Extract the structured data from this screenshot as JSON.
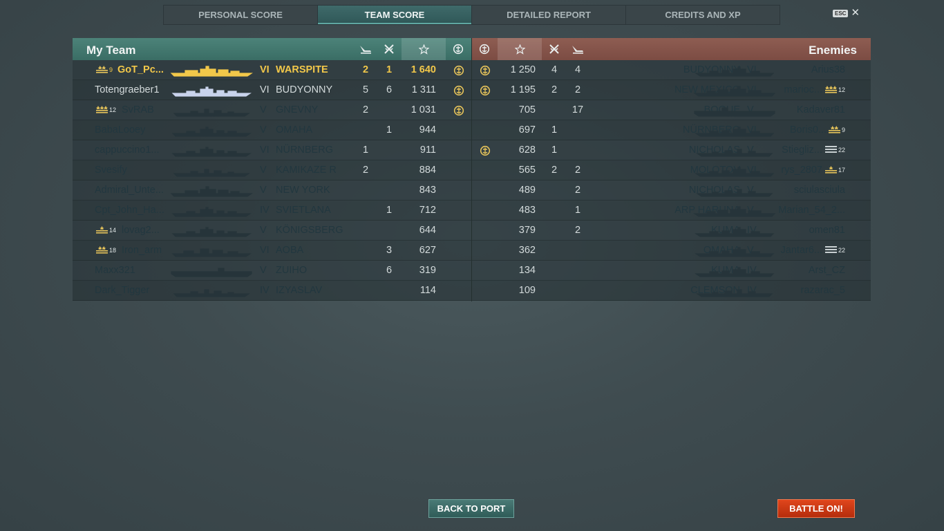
{
  "tabs": [
    "PERSONAL SCORE",
    "TEAM SCORE",
    "DETAILED REPORT",
    "CREDITS AND XP"
  ],
  "active_tab": 1,
  "esc_label": "ESC",
  "colors": {
    "my_team_header": "#4c8379",
    "enemy_header": "#8e5d52",
    "highlight_player": "#f2c84a",
    "battle_button": "#d23d16"
  },
  "my_team": {
    "title": "My Team",
    "header_icons": [
      "plane-icon",
      "crossed-swords-icon",
      "star-icon",
      "emblem-icon"
    ],
    "rows": [
      {
        "player": "GoT_Pc...",
        "rank_level": "9",
        "rank_icon": "ribbon-2-stars",
        "tier": "VI",
        "ship": "WARSPITE",
        "planes": "2",
        "kills": "1",
        "score": "1 640",
        "medal": "yes",
        "style": "me",
        "ship_class": "bb"
      },
      {
        "player": "Totengraeber1",
        "rank_level": "",
        "rank_icon": "",
        "tier": "VI",
        "ship": "BUDYONNY",
        "planes": "5",
        "kills": "6",
        "score": "1 311",
        "medal": "yes",
        "style": "lit",
        "ship_class": "cl"
      },
      {
        "player": "SvRAB",
        "rank_level": "12",
        "rank_icon": "ribbon-3-stars",
        "tier": "V",
        "ship": "GNEVNY",
        "planes": "2",
        "kills": "",
        "score": "1 031",
        "medal": "yes",
        "style": "dim",
        "ship_class": "dd"
      },
      {
        "player": "BabaLooey",
        "rank_level": "",
        "rank_icon": "",
        "tier": "V",
        "ship": "OMAHA",
        "planes": "",
        "kills": "1",
        "score": "944",
        "medal": "",
        "style": "dim",
        "ship_class": "cl"
      },
      {
        "player": "cappuccino1...",
        "rank_level": "",
        "rank_icon": "",
        "tier": "VI",
        "ship": "NÜRNBERG",
        "planes": "1",
        "kills": "",
        "score": "911",
        "medal": "",
        "style": "dim",
        "ship_class": "cl"
      },
      {
        "player": "Svesify",
        "rank_level": "",
        "rank_icon": "",
        "tier": "V",
        "ship": "KAMIKAZE R",
        "planes": "2",
        "kills": "",
        "score": "884",
        "medal": "",
        "style": "dim",
        "ship_class": "dd"
      },
      {
        "player": "Admiral_Unte...",
        "rank_level": "",
        "rank_icon": "",
        "tier": "V",
        "ship": "NEW YORK",
        "planes": "",
        "kills": "",
        "score": "843",
        "medal": "",
        "style": "dim",
        "ship_class": "bb"
      },
      {
        "player": "Cpt_John_Ha...",
        "rank_level": "",
        "rank_icon": "",
        "tier": "IV",
        "ship": "SVIETLANA",
        "planes": "",
        "kills": "1",
        "score": "712",
        "medal": "",
        "style": "dim",
        "ship_class": "cl"
      },
      {
        "player": "lovag2...",
        "rank_level": "14",
        "rank_icon": "ribbon-1-star",
        "tier": "V",
        "ship": "KÖNIGSBERG",
        "planes": "",
        "kills": "",
        "score": "644",
        "medal": "",
        "style": "dim",
        "ship_class": "cl"
      },
      {
        "player": "Iron_arm",
        "rank_level": "18",
        "rank_icon": "ribbon-2-stars",
        "tier": "VI",
        "ship": "AOBA",
        "planes": "",
        "kills": "3",
        "score": "627",
        "medal": "",
        "style": "dim",
        "ship_class": "ca"
      },
      {
        "player": "Maxx321",
        "rank_level": "",
        "rank_icon": "",
        "tier": "V",
        "ship": "ZUIHO",
        "planes": "",
        "kills": "6",
        "score": "319",
        "medal": "",
        "style": "dim",
        "ship_class": "cv"
      },
      {
        "player": "Dark_Tigger",
        "rank_level": "",
        "rank_icon": "",
        "tier": "IV",
        "ship": "IZYASLAV",
        "planes": "",
        "kills": "",
        "score": "114",
        "medal": "",
        "style": "dim",
        "ship_class": "dd"
      }
    ]
  },
  "enemies": {
    "title": "Enemies",
    "header_icons": [
      "emblem-icon",
      "star-icon",
      "crossed-swords-icon",
      "plane-icon"
    ],
    "rows": [
      {
        "player": "Arius38",
        "rank_level": "",
        "rank_icon": "",
        "tier": "VI",
        "ship": "BUDYONNY",
        "planes": "4",
        "kills": "4",
        "score": "1 250",
        "medal": "yes",
        "ship_class": "cl"
      },
      {
        "player": "marioc...",
        "rank_level": "12",
        "rank_icon": "ribbon-3-stars",
        "tier": "VI",
        "ship": "NEW MEXICO",
        "planes": "2",
        "kills": "2",
        "score": "1 195",
        "medal": "yes",
        "ship_class": "bb"
      },
      {
        "player": "Kadaver81",
        "rank_level": "",
        "rank_icon": "",
        "tier": "V",
        "ship": "BOGUE",
        "planes": "",
        "kills": "17",
        "score": "705",
        "medal": "",
        "ship_class": "cv"
      },
      {
        "player": "Boris0...",
        "rank_level": "9",
        "rank_icon": "ribbon-2-stars",
        "tier": "VI",
        "ship": "NÜRNBERG",
        "planes": "1",
        "kills": "",
        "score": "697",
        "medal": "",
        "ship_class": "cl"
      },
      {
        "player": "Stiegliz...",
        "rank_level": "22",
        "rank_icon": "ribbon-plain",
        "tier": "V",
        "ship": "NICHOLAS",
        "planes": "1",
        "kills": "",
        "score": "628",
        "medal": "yes",
        "ship_class": "dd"
      },
      {
        "player": "rys_2807",
        "rank_level": "17",
        "rank_icon": "ribbon-1-star",
        "tier": "VI",
        "ship": "MOLOTOV",
        "planes": "2",
        "kills": "2",
        "score": "565",
        "medal": "",
        "ship_class": "cl"
      },
      {
        "player": "sciulasciula",
        "rank_level": "",
        "rank_icon": "",
        "tier": "V",
        "ship": "NICHOLAS",
        "planes": "",
        "kills": "2",
        "score": "489",
        "medal": "",
        "ship_class": "dd"
      },
      {
        "player": "Marian_54_2...",
        "rank_level": "",
        "rank_icon": "",
        "tier": "V",
        "ship": "ARP HARUNA",
        "planes": "",
        "kills": "1",
        "score": "483",
        "medal": "",
        "ship_class": "bb"
      },
      {
        "player": "omen81",
        "rank_level": "",
        "rank_icon": "",
        "tier": "IV",
        "ship": "KUMA",
        "planes": "",
        "kills": "2",
        "score": "379",
        "medal": "",
        "ship_class": "cl"
      },
      {
        "player": "Jantar6...",
        "rank_level": "22",
        "rank_icon": "ribbon-plain",
        "tier": "V",
        "ship": "OMAHA",
        "planes": "",
        "kills": "",
        "score": "362",
        "medal": "",
        "ship_class": "cl"
      },
      {
        "player": "Arst_CZ",
        "rank_level": "",
        "rank_icon": "",
        "tier": "IV",
        "ship": "KUMA",
        "planes": "",
        "kills": "",
        "score": "134",
        "medal": "",
        "ship_class": "cl"
      },
      {
        "player": "razarac_5",
        "rank_level": "",
        "rank_icon": "",
        "tier": "IV",
        "ship": "CLEMSON",
        "planes": "",
        "kills": "",
        "score": "109",
        "medal": "",
        "ship_class": "dd"
      }
    ]
  },
  "buttons": {
    "back": "BACK TO PORT",
    "battle": "BATTLE ON!"
  }
}
